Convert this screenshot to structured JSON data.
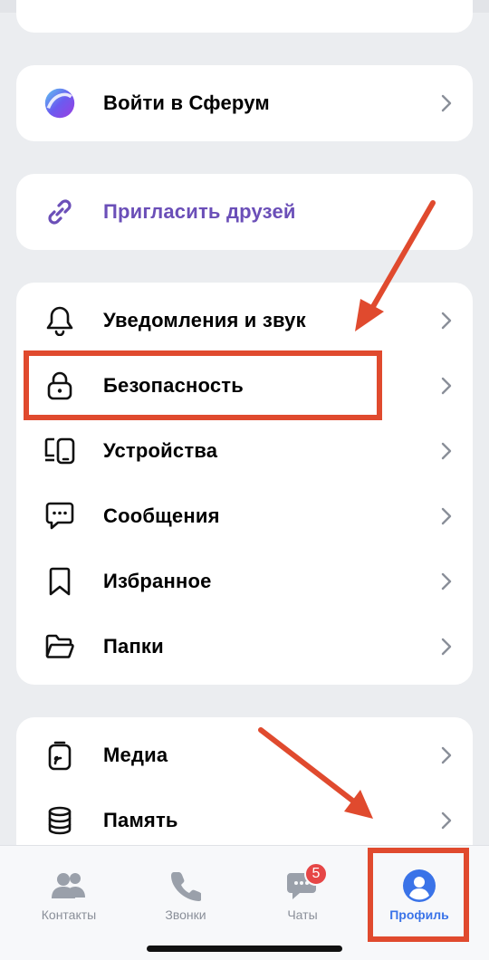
{
  "menu": {
    "sferum": {
      "label": "Войти в Сферум"
    },
    "invite": {
      "label": "Пригласить друзей"
    },
    "settings": [
      {
        "id": "notifications",
        "label": "Уведомления и звук",
        "icon": "bell-icon"
      },
      {
        "id": "security",
        "label": "Безопасность",
        "icon": "lock-icon"
      },
      {
        "id": "devices",
        "label": "Устройства",
        "icon": "devices-icon"
      },
      {
        "id": "messages",
        "label": "Сообщения",
        "icon": "message-icon"
      },
      {
        "id": "favorites",
        "label": "Избранное",
        "icon": "bookmark-icon"
      },
      {
        "id": "folders",
        "label": "Папки",
        "icon": "folder-icon"
      }
    ],
    "storage": [
      {
        "id": "media",
        "label": "Медиа",
        "icon": "media-icon"
      },
      {
        "id": "memory",
        "label": "Память",
        "icon": "database-icon"
      }
    ]
  },
  "tabbar": {
    "tabs": [
      {
        "id": "contacts",
        "label": "Контакты",
        "icon": "contacts-icon"
      },
      {
        "id": "calls",
        "label": "Звонки",
        "icon": "phone-icon"
      },
      {
        "id": "chats",
        "label": "Чаты",
        "icon": "chat-icon",
        "badge": "5"
      },
      {
        "id": "profile",
        "label": "Профиль",
        "icon": "profile-icon",
        "active": true
      }
    ]
  },
  "colors": {
    "accent": "#6b4fb8",
    "active_tab": "#3a73e8",
    "highlight": "#e04a2e",
    "badge": "#e64646"
  }
}
